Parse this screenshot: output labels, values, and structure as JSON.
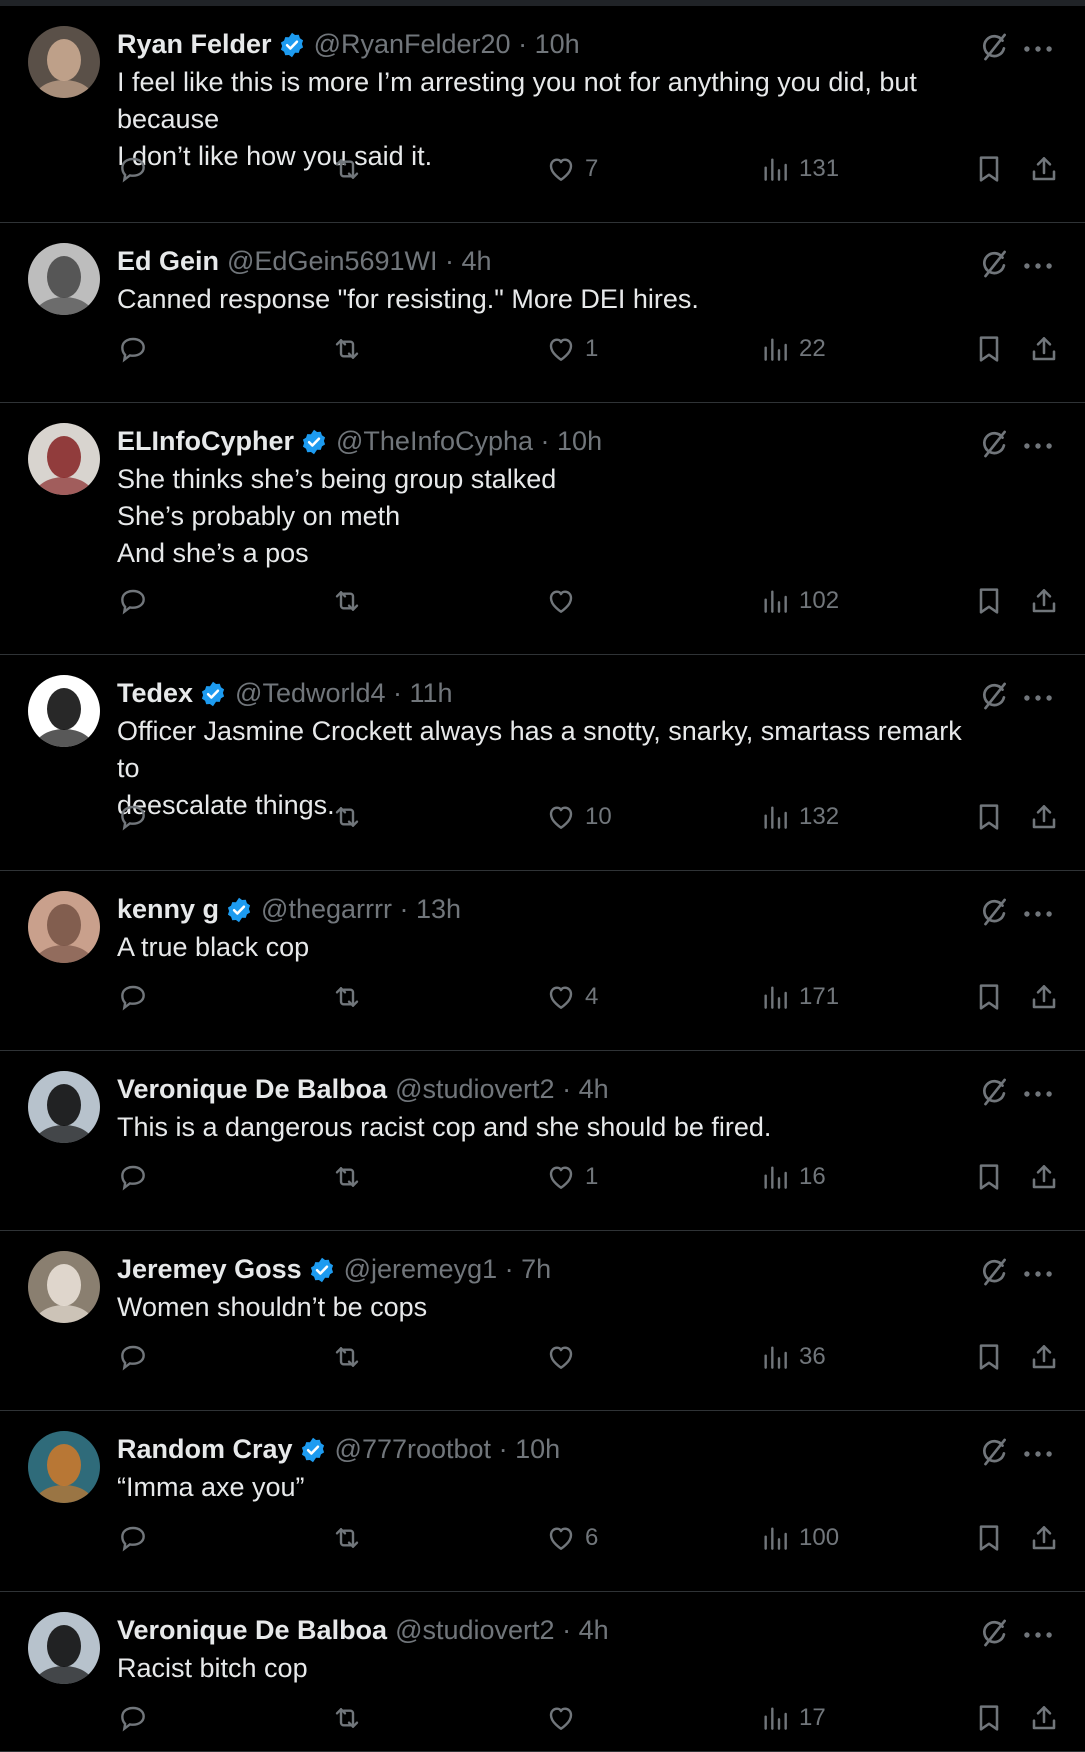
{
  "tweets": [
    {
      "name": "Ryan Felder",
      "verified": true,
      "handle": "@RyanFelder20",
      "time": "10h",
      "lines": [
        "I feel like this is more I’m arresting you not for anything you did, but because",
        "I don’t like how you said it."
      ],
      "likes": "7",
      "views": "131",
      "avatar": {
        "bg": "#5a5048",
        "fg": "#c9a890"
      }
    },
    {
      "name": "Ed Gein",
      "verified": false,
      "handle": "@EdGein5691WI",
      "time": "4h",
      "lines": [
        "Canned response \"for resisting.\" More DEI hires."
      ],
      "likes": "1",
      "views": "22",
      "avatar": {
        "bg": "#bdbdbd",
        "fg": "#4a4a4a"
      }
    },
    {
      "name": "ELInfoCypher",
      "verified": true,
      "handle": "@TheInfoCypha",
      "time": "10h",
      "lines": [
        "She thinks she’s being group stalked",
        "She’s probably on meth",
        "And she’s a pos"
      ],
      "likes": "",
      "views": "102",
      "avatar": {
        "bg": "#d8d4cf",
        "fg": "#8a2b2b"
      }
    },
    {
      "name": "Tedex",
      "verified": true,
      "handle": "@Tedworld4",
      "time": "11h",
      "lines": [
        "Officer Jasmine Crockett always has a snotty, snarky, smartass remark to",
        "deescalate things."
      ],
      "likes": "10",
      "views": "132",
      "avatar": {
        "bg": "#ffffff",
        "fg": "#111111"
      }
    },
    {
      "name": "kenny g",
      "verified": true,
      "handle": "@thegarrrr",
      "time": "13h",
      "lines": [
        "A true black cop"
      ],
      "likes": "4",
      "views": "171",
      "avatar": {
        "bg": "#c9a08c",
        "fg": "#7a5648"
      }
    },
    {
      "name": "Veronique De Balboa",
      "verified": false,
      "handle": "@studiovert2",
      "time": "4h",
      "lines": [
        "This is a dangerous racist cop and she should be fired."
      ],
      "likes": "1",
      "views": "16",
      "avatar": {
        "bg": "#b7c2cc",
        "fg": "#111111"
      }
    },
    {
      "name": "Jeremey Goss",
      "verified": true,
      "handle": "@jeremeyg1",
      "time": "7h",
      "lines": [
        "Women shouldn’t be cops"
      ],
      "likes": "",
      "views": "36",
      "avatar": {
        "bg": "#8a7f70",
        "fg": "#e8e0d6"
      }
    },
    {
      "name": "Random Cray",
      "verified": true,
      "handle": "@777rootbot",
      "time": "10h",
      "lines": [
        "“Imma axe you”"
      ],
      "likes": "6",
      "views": "100",
      "avatar": {
        "bg": "#2f6b7a",
        "fg": "#c8792e"
      }
    },
    {
      "name": "Veronique De Balboa",
      "verified": false,
      "handle": "@studiovert2",
      "time": "4h",
      "lines": [
        "Racist bitch cop"
      ],
      "likes": "",
      "views": "17",
      "avatar": {
        "bg": "#b7c2cc",
        "fg": "#111111"
      }
    }
  ],
  "colors": {
    "background": "#000000",
    "text": "#e7e9ea",
    "muted": "#71767b",
    "verified": "#1d9bf0",
    "divider": "#2f3336"
  },
  "icons": {
    "reply": "reply-icon",
    "retweet": "retweet-icon",
    "like": "heart-icon",
    "views": "views-icon",
    "bookmark": "bookmark-icon",
    "share": "share-icon",
    "grok": "grok-icon",
    "more": "more-icon",
    "verified": "verified-badge-icon"
  }
}
